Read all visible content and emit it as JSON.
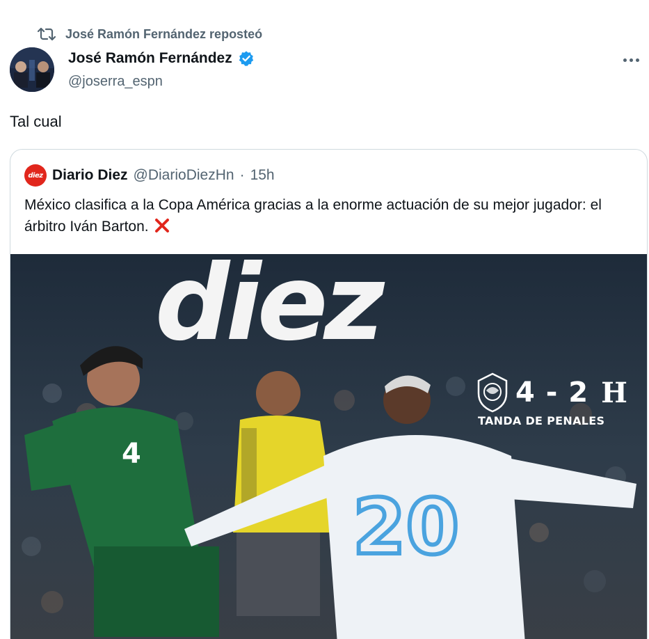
{
  "repost": {
    "label": "José Ramón Fernández reposteó",
    "icon": "repost-icon"
  },
  "author": {
    "name": "José Ramón Fernández",
    "handle": "@joserra_espn",
    "verified": true,
    "verified_color": "#1d9bf0"
  },
  "tweet": {
    "text": "Tal cual"
  },
  "quote": {
    "avatar_text": "diez",
    "name": "Diario Diez",
    "handle": "@DiarioDiezHn",
    "separator": "·",
    "time": "15h",
    "text": "México clasifica a la Copa América gracias a la enorme actuación de su mejor jugador: el árbitro Iván Barton.",
    "emoji": "cross-mark-icon",
    "emoji_color": "#e1261c"
  },
  "media": {
    "logo_text": "diez",
    "score": "4 - 2",
    "team_mark": "H",
    "caption": "TANDA DE PENALES",
    "player_left_number": "4",
    "player_right_number": "20"
  }
}
